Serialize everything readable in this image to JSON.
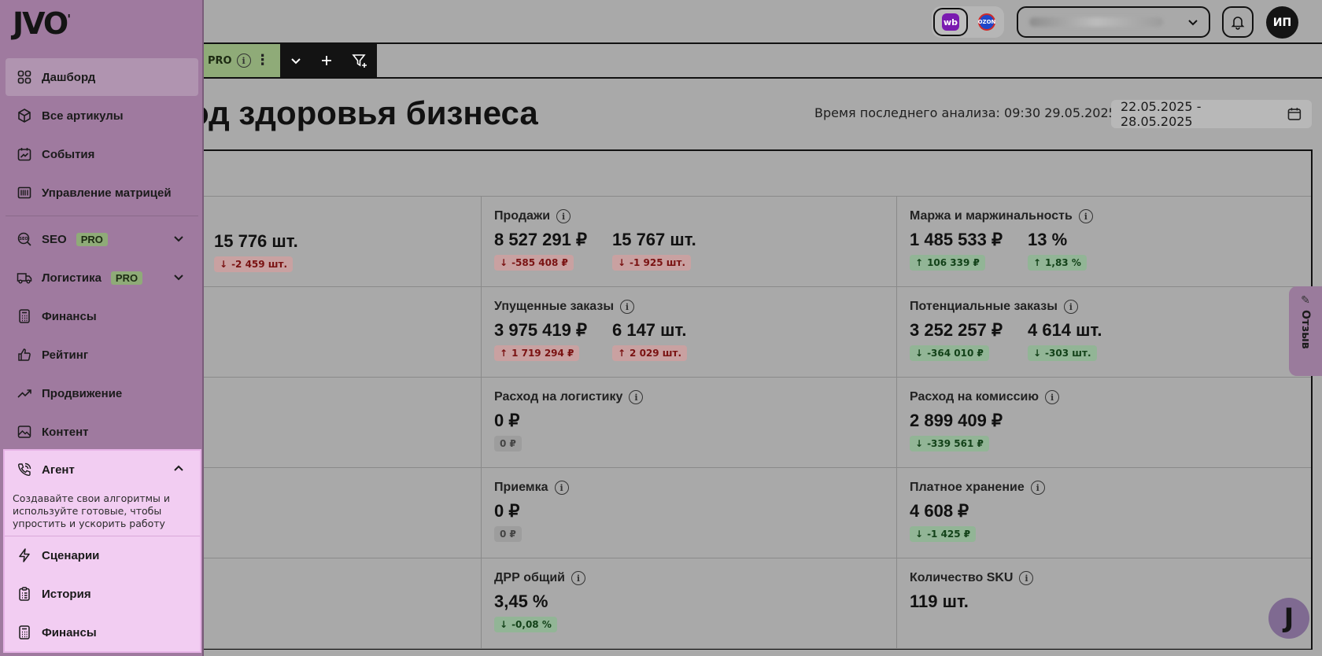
{
  "brand": {
    "logo_text": "JVO"
  },
  "header": {
    "marketplaces": [
      {
        "name": "wb",
        "icon": "wildberries-logo"
      },
      {
        "name": "OZON",
        "icon": "ozon-logo"
      }
    ],
    "avatar_initials": "ИП"
  },
  "filters": {
    "pro_label": "PRO"
  },
  "page": {
    "title": "од здоровья бизнеса",
    "analysis_label": "Время последнего анализа:",
    "analysis_time": "09:30 29.05.2025",
    "date_range": "22.05.2025 - 28.05.2025"
  },
  "sidebar": {
    "items": [
      {
        "label": "Дашборд",
        "icon": "grid-icon",
        "active": true
      },
      {
        "label": "Все артикулы",
        "icon": "box-icon"
      },
      {
        "label": "События",
        "icon": "calendar-chart-icon"
      },
      {
        "label": "Управление матрицей",
        "icon": "barcode-icon"
      },
      {
        "label": "SEO",
        "icon": "seo-icon",
        "badge": "PRO"
      },
      {
        "label": "Логистика",
        "icon": "truck-icon",
        "badge": "PRO"
      },
      {
        "label": "Финансы",
        "icon": "calculator-icon"
      },
      {
        "label": "Рейтинг",
        "icon": "thumbs-up-icon"
      },
      {
        "label": "Продвижение",
        "icon": "trend-icon"
      },
      {
        "label": "Контент",
        "icon": "image-icon"
      }
    ],
    "agent": {
      "label": "Агент",
      "description": "Создавайте свои алгоритмы и используйте готовые, чтобы упростить и ускорить работу",
      "items": [
        {
          "label": "Сценарии",
          "icon": "lightning-icon"
        },
        {
          "label": "История",
          "icon": "clipboard-icon"
        },
        {
          "label": "Финансы",
          "icon": "calculator-icon"
        }
      ]
    }
  },
  "metrics": {
    "r1c1": {
      "v1": "15 776 шт.",
      "d1": "-2 459 шт."
    },
    "r1c2": {
      "title": "Продажи",
      "v1": "8 527 291 ₽",
      "d1": "-585 408 ₽",
      "v2": "15 767 шт.",
      "d2": "-1 925 шт."
    },
    "r1c3": {
      "title": "Маржа и маржинальность",
      "v1": "1 485 533 ₽",
      "d1": "106 339 ₽",
      "v2": "13 %",
      "d2": "1,83 %"
    },
    "r2c2": {
      "title": "Упущенные заказы",
      "v1": "3 975 419 ₽",
      "d1": "1 719 294 ₽",
      "v2": "6 147 шт.",
      "d2": "2 029 шт."
    },
    "r2c3": {
      "title": "Потенциальные заказы",
      "v1": "3 252 257 ₽",
      "d1": "-364 010 ₽",
      "v2": "4 614 шт.",
      "d2": "-303 шт."
    },
    "r3c2": {
      "title": "Расход на логистику",
      "v1": "0 ₽",
      "d1": "0 ₽"
    },
    "r3c3": {
      "title": "Расход на комиссию",
      "v1": "2 899 409 ₽",
      "d1": "-339 561 ₽"
    },
    "r4c2": {
      "title": "Приемка",
      "v1": "0 ₽",
      "d1": "0 ₽"
    },
    "r4c3": {
      "title": "Платное хранение",
      "v1": "4 608 ₽",
      "d1": "-1 425 ₽"
    },
    "r5c2": {
      "title": "ДРР общий",
      "v1": "3,45 %",
      "d1": "-0,08 %"
    },
    "r5c3": {
      "title": "Количество SKU",
      "v1": "119 шт."
    }
  },
  "feedback": {
    "label": "Отзыв"
  },
  "colors": {
    "overlay_gray": "#a9a9a9",
    "sidebar": "#9f7a9f",
    "agent_highlight": "#f2cdf2",
    "pro_badge": "#8fab78",
    "negative_badge": "#c9a1a1",
    "positive_badge": "#92b596"
  }
}
